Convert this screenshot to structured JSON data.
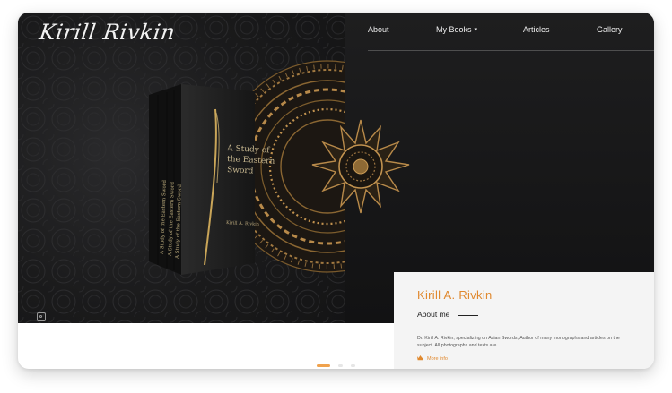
{
  "brand": {
    "logo_text": "Kirill Rivkin"
  },
  "nav": {
    "items": [
      {
        "label": "About"
      },
      {
        "label": "My Books",
        "has_dropdown": true
      },
      {
        "label": "Articles"
      },
      {
        "label": "Gallery"
      }
    ]
  },
  "hero": {
    "book_title": "A Study of the Eastern Sword",
    "book_spine_text": "A Study of the Eastern Sword"
  },
  "about": {
    "name": "Kirill A. Rivkin",
    "heading": "About me",
    "text": "Dr. Kirill A. Rivkin, specializing on Asian Swords, Author of many monographs and articles on the subject. All photographs and texts are",
    "more_label": "More info"
  },
  "slider": {
    "count": 3,
    "active_index": 0
  },
  "colors": {
    "accent": "#e0892f",
    "dark_bg": "#1b1b1c",
    "gold": "#b88a4a",
    "panel_bg": "#f4f4f4"
  },
  "icons": {
    "instagram": "instagram-icon",
    "more_info": "crown-icon",
    "dropdown": "caret-down-icon"
  }
}
